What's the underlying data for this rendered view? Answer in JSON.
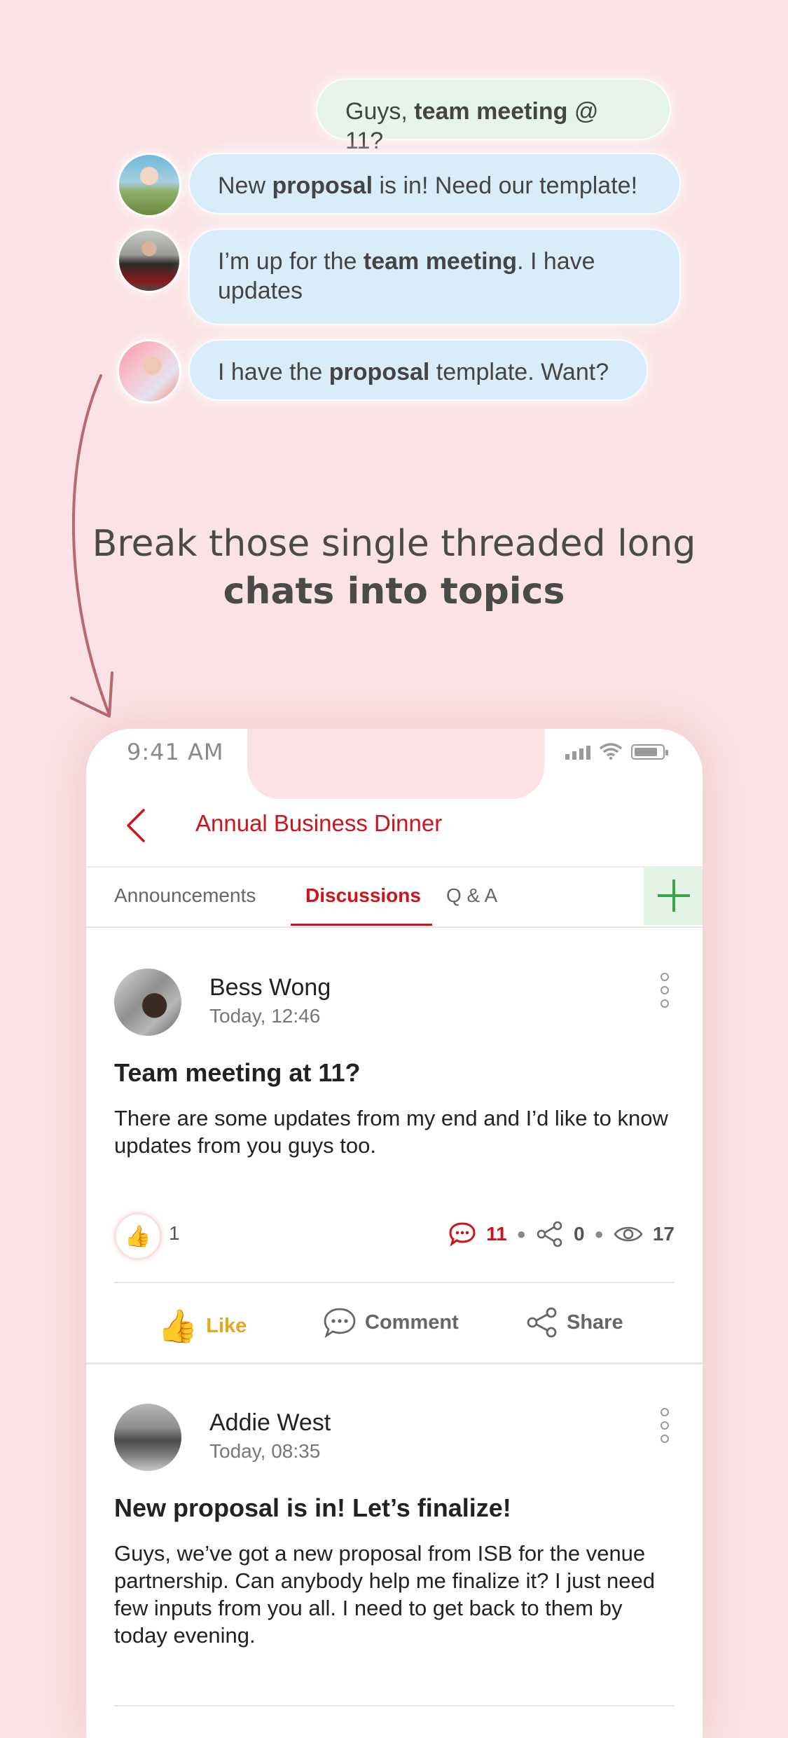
{
  "chat": {
    "m1": {
      "pre": "Guys, ",
      "bold": "team meeting",
      "post": " @ 11?"
    },
    "m2": {
      "pre": "New ",
      "bold": "proposal",
      "post": " is in! Need our template!"
    },
    "m3": {
      "pre": "I’m up for the ",
      "bold": "team meeting",
      "post": ". I have updates"
    },
    "m4": {
      "pre": "I have the ",
      "bold": "proposal",
      "post": " template. Want?"
    }
  },
  "headline": {
    "line1": "Break those single threaded long",
    "line2": "chats into topics"
  },
  "status": {
    "time": "9:41 AM"
  },
  "header": {
    "title": "Annual Business Dinner"
  },
  "tabs": [
    {
      "label": "Announcements"
    },
    {
      "label": "Discussions",
      "active": true
    },
    {
      "label": "Q & A"
    }
  ],
  "posts": [
    {
      "author": "Bess Wong",
      "time": "Today, 12:46",
      "title": "Team meeting at 11?",
      "body": "There are some updates from my end and I’d like to know updates from you guys too.",
      "likes": "1",
      "comments": "11",
      "shares": "0",
      "views": "17"
    },
    {
      "author": "Addie West",
      "time": "Today, 08:35",
      "title": "New proposal is in! Let’s finalize!",
      "body": "Guys, we’ve got a new proposal from ISB for the venue partnership. Can anybody help me finalize it? I just need few inputs from you all. I need to get back to them by today evening."
    }
  ],
  "actions": {
    "like": "Like",
    "comment": "Comment",
    "share": "Share"
  },
  "colors": {
    "accent": "#d0121b",
    "background": "#fbe2e4",
    "add": "#3aa548",
    "like": "#e6a71c"
  }
}
